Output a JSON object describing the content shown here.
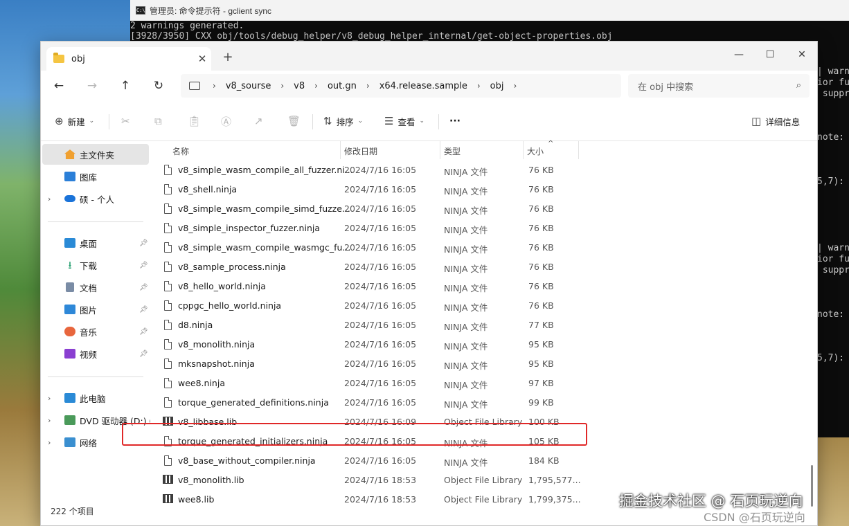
{
  "console": {
    "title": "管理员: 命令提示符 - gclient  sync",
    "lines": [
      "2 warnings generated.",
      "[3928/3950] CXX obj/tools/debug_helper/v8_debug_helper_internal/get-object-properties.obj"
    ],
    "right_fragments": [
      "| warn",
      "ior fu",
      " suppr",
      "note:",
      "5,7):",
      "| warn",
      "ior fu",
      " suppr",
      "note:",
      "5,7):"
    ]
  },
  "explorer": {
    "tab_title": "obj",
    "tab_close": "✕",
    "tab_new": "+",
    "window_controls": {
      "minimize": "—",
      "maximize": "☐",
      "close": "✕"
    },
    "nav": {
      "back": "←",
      "forward": "→",
      "up": "↑",
      "refresh": "↻"
    },
    "breadcrumbs": [
      "v8_sourse",
      "v8",
      "out.gn",
      "x64.release.sample",
      "obj"
    ],
    "crumb_separator": "›",
    "search_placeholder": "在 obj 中搜索",
    "toolbar": {
      "new_label": "新建",
      "sort_label": "排序",
      "view_label": "查看",
      "more_label": "···",
      "details_label": "详细信息"
    },
    "sidebar": {
      "items": [
        {
          "label": "主文件夹",
          "icon": "home-icon"
        },
        {
          "label": "图库",
          "icon": "gallery-icon"
        },
        {
          "label": "硕 - 个人",
          "icon": "onedrive-icon"
        },
        {
          "label": "桌面",
          "icon": "desktop-icon"
        },
        {
          "label": "下载",
          "icon": "download-icon"
        },
        {
          "label": "文档",
          "icon": "document-icon"
        },
        {
          "label": "图片",
          "icon": "pictures-icon"
        },
        {
          "label": "音乐",
          "icon": "music-icon"
        },
        {
          "label": "视频",
          "icon": "video-icon"
        },
        {
          "label": "此电脑",
          "icon": "this-pc-icon"
        },
        {
          "label": "DVD 驱动器 (D:) C",
          "icon": "dvd-drive-icon"
        },
        {
          "label": "网络",
          "icon": "network-icon"
        }
      ]
    },
    "columns": {
      "name": "名称",
      "date": "修改日期",
      "type": "类型",
      "size": "大小"
    },
    "files": [
      {
        "name": "v8_simple_wasm_compile_all_fuzzer.ni...",
        "date": "2024/7/16 16:05",
        "type": "NINJA 文件",
        "size": "76 KB",
        "kind": "file"
      },
      {
        "name": "v8_shell.ninja",
        "date": "2024/7/16 16:05",
        "type": "NINJA 文件",
        "size": "76 KB",
        "kind": "file"
      },
      {
        "name": "v8_simple_wasm_compile_simd_fuzze...",
        "date": "2024/7/16 16:05",
        "type": "NINJA 文件",
        "size": "76 KB",
        "kind": "file"
      },
      {
        "name": "v8_simple_inspector_fuzzer.ninja",
        "date": "2024/7/16 16:05",
        "type": "NINJA 文件",
        "size": "76 KB",
        "kind": "file"
      },
      {
        "name": "v8_simple_wasm_compile_wasmgc_fu...",
        "date": "2024/7/16 16:05",
        "type": "NINJA 文件",
        "size": "76 KB",
        "kind": "file"
      },
      {
        "name": "v8_sample_process.ninja",
        "date": "2024/7/16 16:05",
        "type": "NINJA 文件",
        "size": "76 KB",
        "kind": "file"
      },
      {
        "name": "v8_hello_world.ninja",
        "date": "2024/7/16 16:05",
        "type": "NINJA 文件",
        "size": "76 KB",
        "kind": "file"
      },
      {
        "name": "cppgc_hello_world.ninja",
        "date": "2024/7/16 16:05",
        "type": "NINJA 文件",
        "size": "76 KB",
        "kind": "file"
      },
      {
        "name": "d8.ninja",
        "date": "2024/7/16 16:05",
        "type": "NINJA 文件",
        "size": "77 KB",
        "kind": "file"
      },
      {
        "name": "v8_monolith.ninja",
        "date": "2024/7/16 16:05",
        "type": "NINJA 文件",
        "size": "95 KB",
        "kind": "file"
      },
      {
        "name": "mksnapshot.ninja",
        "date": "2024/7/16 16:05",
        "type": "NINJA 文件",
        "size": "95 KB",
        "kind": "file"
      },
      {
        "name": "wee8.ninja",
        "date": "2024/7/16 16:05",
        "type": "NINJA 文件",
        "size": "97 KB",
        "kind": "file"
      },
      {
        "name": "torque_generated_definitions.ninja",
        "date": "2024/7/16 16:05",
        "type": "NINJA 文件",
        "size": "99 KB",
        "kind": "file"
      },
      {
        "name": "v8_libbase.lib",
        "date": "2024/7/16 16:09",
        "type": "Object File Library",
        "size": "100 KB",
        "kind": "lib"
      },
      {
        "name": "torque_generated_initializers.ninja",
        "date": "2024/7/16 16:05",
        "type": "NINJA 文件",
        "size": "105 KB",
        "kind": "file"
      },
      {
        "name": "v8_base_without_compiler.ninja",
        "date": "2024/7/16 16:05",
        "type": "NINJA 文件",
        "size": "184 KB",
        "kind": "file"
      },
      {
        "name": "v8_monolith.lib",
        "date": "2024/7/16 18:53",
        "type": "Object File Library",
        "size": "1,795,577...",
        "kind": "lib"
      },
      {
        "name": "wee8.lib",
        "date": "2024/7/16 18:53",
        "type": "Object File Library",
        "size": "1,799,375...",
        "kind": "lib"
      }
    ],
    "status": "222 个项目",
    "highlight_color": "#e02828"
  },
  "watermark": {
    "primary": "掘金技术社区 @ 石页玩逆向",
    "secondary": "CSDN @石页玩逆向"
  }
}
